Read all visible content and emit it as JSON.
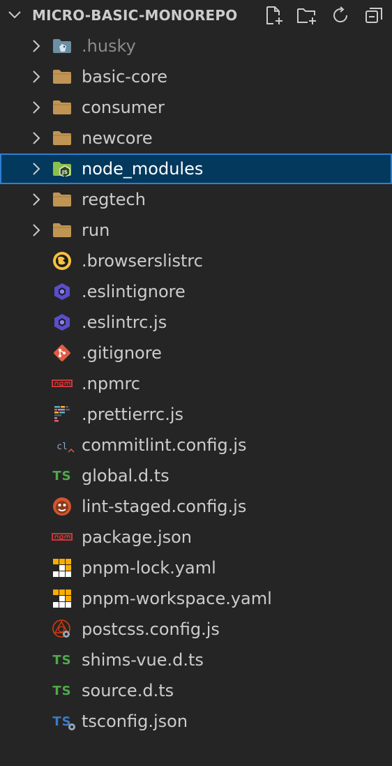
{
  "explorer": {
    "title": "MICRO-BASIC-MONOREPO",
    "actions": [
      {
        "name": "new-file-icon"
      },
      {
        "name": "new-folder-icon"
      },
      {
        "name": "refresh-icon"
      },
      {
        "name": "collapse-all-icon"
      }
    ]
  },
  "tree": {
    "items": [
      {
        "label": ".husky",
        "type": "folder",
        "icon": "husky-folder-icon",
        "dim": true
      },
      {
        "label": "basic-core",
        "type": "folder",
        "icon": "folder-icon"
      },
      {
        "label": "consumer",
        "type": "folder",
        "icon": "folder-icon"
      },
      {
        "label": "newcore",
        "type": "folder",
        "icon": "folder-icon"
      },
      {
        "label": "node_modules",
        "type": "folder",
        "icon": "node-folder-icon",
        "selected": true
      },
      {
        "label": "regtech",
        "type": "folder",
        "icon": "folder-icon"
      },
      {
        "label": "run",
        "type": "folder",
        "icon": "folder-icon"
      },
      {
        "label": ".browserslistrc",
        "type": "file",
        "icon": "browserslist-icon"
      },
      {
        "label": ".eslintignore",
        "type": "file",
        "icon": "eslint-icon"
      },
      {
        "label": ".eslintrc.js",
        "type": "file",
        "icon": "eslint-icon"
      },
      {
        "label": ".gitignore",
        "type": "file",
        "icon": "git-icon"
      },
      {
        "label": ".npmrc",
        "type": "file",
        "icon": "npm-icon"
      },
      {
        "label": ".prettierrc.js",
        "type": "file",
        "icon": "prettier-icon"
      },
      {
        "label": "commitlint.config.js",
        "type": "file",
        "icon": "commitlint-icon"
      },
      {
        "label": "global.d.ts",
        "type": "file",
        "icon": "typescript-def-icon"
      },
      {
        "label": "lint-staged.config.js",
        "type": "file",
        "icon": "lint-staged-icon"
      },
      {
        "label": "package.json",
        "type": "file",
        "icon": "npm-icon"
      },
      {
        "label": "pnpm-lock.yaml",
        "type": "file",
        "icon": "pnpm-icon"
      },
      {
        "label": "pnpm-workspace.yaml",
        "type": "file",
        "icon": "pnpm-icon"
      },
      {
        "label": "postcss.config.js",
        "type": "file",
        "icon": "postcss-icon"
      },
      {
        "label": "shims-vue.d.ts",
        "type": "file",
        "icon": "typescript-def-icon"
      },
      {
        "label": "source.d.ts",
        "type": "file",
        "icon": "typescript-def-icon"
      },
      {
        "label": "tsconfig.json",
        "type": "file",
        "icon": "tsconfig-icon"
      }
    ]
  },
  "icon_text": {
    "typescript": "TS",
    "commitlint": "cl",
    "npm": "npm"
  },
  "colors": {
    "background": "#252526",
    "selection_bg": "#04395e",
    "selection_border": "#2f7fd2",
    "folder": "#c09553",
    "text": "#cccccc"
  }
}
